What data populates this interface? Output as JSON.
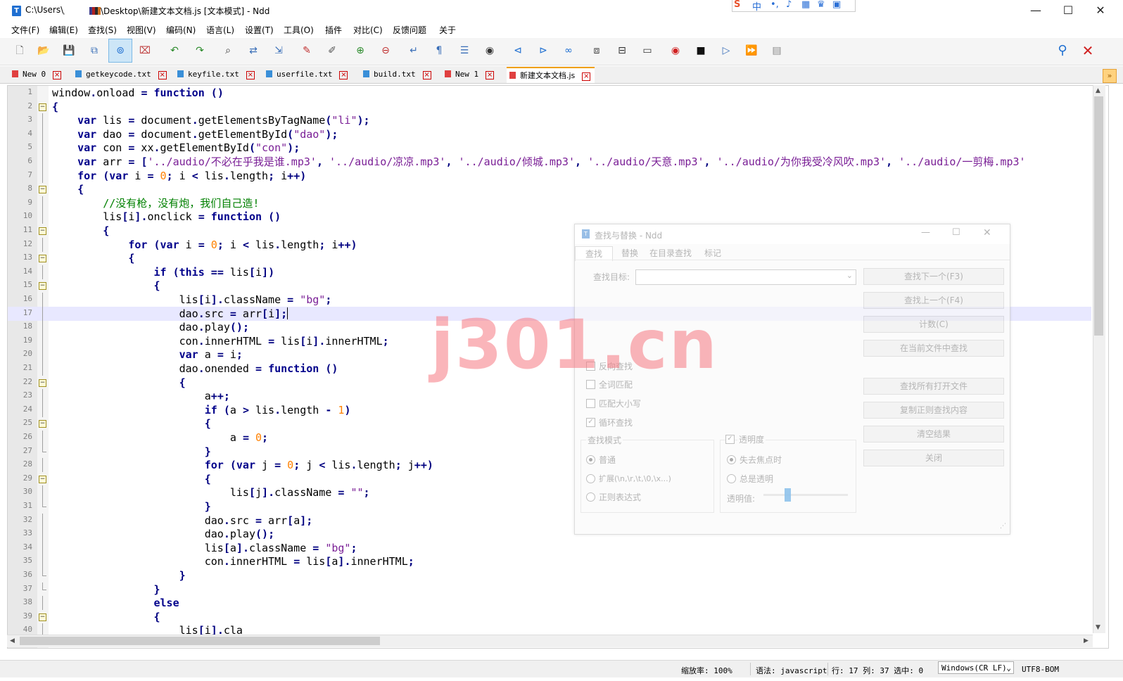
{
  "window": {
    "title_part1": "C:\\Users\\ ̣",
    "title_part2": "\\Desktop\\新建文本文档.js [文本模式] - Ndd",
    "minimize": "—",
    "maximize": "☐",
    "close": "✕"
  },
  "menu": [
    "文件(F)",
    "编辑(E)",
    "查找(S)",
    "视图(V)",
    "编码(N)",
    "语言(L)",
    "设置(T)",
    "工具(O)",
    "插件",
    "对比(C)",
    "反馈问题",
    "关于"
  ],
  "tabs": [
    {
      "label": "New 0",
      "icon_color": "#e04040"
    },
    {
      "label": "getkeycode.txt",
      "icon_color": "#3a8fd8"
    },
    {
      "label": "keyfile.txt",
      "icon_color": "#3a8fd8"
    },
    {
      "label": "userfile.txt",
      "icon_color": "#3a8fd8"
    },
    {
      "label": "build.txt",
      "icon_color": "#3a8fd8"
    },
    {
      "label": "New 1",
      "icon_color": "#e04040"
    },
    {
      "label": "新建文本文档.js",
      "icon_color": "#e04040"
    }
  ],
  "editor": {
    "lines": [
      "window.onload = function ()",
      "{",
      "    var lis = document.getElementsByTagName(\"li\");",
      "    var dao = document.getElementById(\"dao\");",
      "    var con = xx.getElementById(\"con\");",
      "    var arr = ['../audio/不必在乎我是谁.mp3', '../audio/凉凉.mp3', '../audio/倾城.mp3', '../audio/天意.mp3', '../audio/为你我受冷风吹.mp3', '../audio/一剪梅.mp3'",
      "    for (var i = 0; i < lis.length; i++)",
      "    {",
      "        //没有枪，没有炮，我们自己造!",
      "        lis[i].onclick = function ()",
      "        {",
      "            for (var i = 0; i < lis.length; i++)",
      "            {",
      "                if (this == lis[i])",
      "                {",
      "                    lis[i].className = \"bg\";",
      "                    dao.src = arr[i];",
      "                    dao.play();",
      "                    con.innerHTML = lis[i].innerHTML;",
      "                    var a = i;",
      "                    dao.onended = function ()",
      "                    {",
      "                        a++;",
      "                        if (a > lis.length - 1)",
      "                        {",
      "                            a = 0;",
      "                        }",
      "                        for (var j = 0; j < lis.length; j++)",
      "                        {",
      "                            lis[j].className = \"\";",
      "                        }",
      "                        dao.src = arr[a];",
      "                        dao.play();",
      "                        lis[a].className = \"bg\";",
      "                        con.innerHTML = lis[a].innerHTML;",
      "                    }",
      "                }",
      "                else",
      "                {",
      "                    lis[i].cla"
    ],
    "current_line": 17
  },
  "find_dialog": {
    "title": "查找与替换 - Ndd",
    "tabs": [
      "查找",
      "替换",
      "在目录查找",
      "标记"
    ],
    "find_target_label": "查找目标:",
    "buttons": [
      "查找下一个(F3)",
      "查找上一个(F4)",
      "计数(C)",
      "在当前文件中查找",
      "查找所有打开文件",
      "复制正则查找内容",
      "清空结果",
      "关闭"
    ],
    "options": [
      {
        "label": "反向查找",
        "checked": false
      },
      {
        "label": "全词匹配",
        "checked": false
      },
      {
        "label": "匹配大小写",
        "checked": false
      },
      {
        "label": "循环查找",
        "checked": true
      }
    ],
    "mode_group": "查找模式",
    "modes": [
      {
        "label": "普通",
        "selected": true
      },
      {
        "label": "扩展(\\n,\\r,\\t,\\0,\\x...)",
        "selected": false
      },
      {
        "label": "正则表达式",
        "selected": false
      }
    ],
    "transparency": {
      "label": "透明度",
      "checked": true,
      "options": [
        {
          "label": "失去焦点时",
          "selected": true
        },
        {
          "label": "总是透明",
          "selected": false
        }
      ],
      "value_label": "透明值:"
    }
  },
  "watermark": "j301.cn",
  "status": {
    "zoom": "缩放率: 100%",
    "syntax": "语法: javascript",
    "position": "行: 17 列: 37 选中: 0",
    "eol": "Windows(CR LF)",
    "encoding": "UTF8-BOM"
  },
  "ime": {
    "lang": "中"
  },
  "colors": {
    "accent_tab": "#f0a000",
    "keyword": "#00008b",
    "string": "#7a1f96",
    "number": "#ff8000",
    "comment": "#008000",
    "current_line": "#e8e8ff"
  }
}
